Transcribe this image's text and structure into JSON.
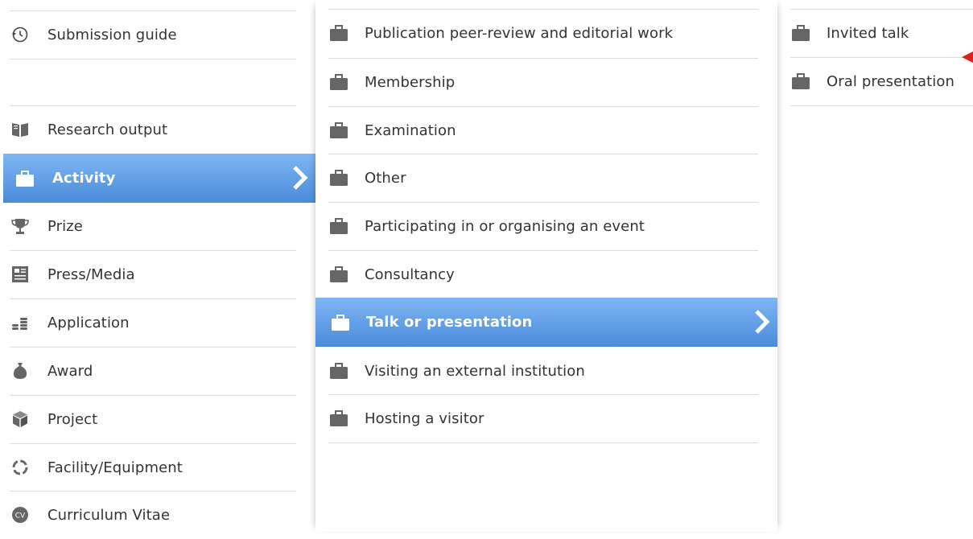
{
  "column1": {
    "items": [
      {
        "label": "Submission guide",
        "icon": "history-icon"
      },
      {
        "label": "",
        "icon": ""
      },
      {
        "label": "Research output",
        "icon": "book-icon"
      },
      {
        "label": "Activity",
        "icon": "briefcase-icon",
        "selected": true
      },
      {
        "label": "Prize",
        "icon": "trophy-icon"
      },
      {
        "label": "Press/Media",
        "icon": "newspaper-icon"
      },
      {
        "label": "Application",
        "icon": "coins-icon"
      },
      {
        "label": "Award",
        "icon": "money-bag-icon"
      },
      {
        "label": "Project",
        "icon": "cube-icon"
      },
      {
        "label": "Facility/Equipment",
        "icon": "lifebuoy-icon"
      },
      {
        "label": "Curriculum Vitae",
        "icon": "cv-icon"
      }
    ]
  },
  "column2": {
    "items": [
      {
        "label": "Publication peer-review and editorial work",
        "icon": "briefcase-icon"
      },
      {
        "label": "Membership",
        "icon": "briefcase-icon"
      },
      {
        "label": "Examination",
        "icon": "briefcase-icon"
      },
      {
        "label": "Other",
        "icon": "briefcase-icon"
      },
      {
        "label": "Participating in or organising an event",
        "icon": "briefcase-icon"
      },
      {
        "label": "Consultancy",
        "icon": "briefcase-icon"
      },
      {
        "label": "Talk or presentation",
        "icon": "briefcase-icon",
        "selected": true
      },
      {
        "label": "Visiting an external institution",
        "icon": "briefcase-icon"
      },
      {
        "label": "Hosting a visitor",
        "icon": "briefcase-icon"
      }
    ]
  },
  "column3": {
    "items": [
      {
        "label": "Invited talk",
        "icon": "briefcase-icon"
      },
      {
        "label": "Oral presentation",
        "icon": "briefcase-icon"
      }
    ]
  },
  "colors": {
    "selected_gradient_top": "#7eb6f4",
    "selected_gradient_bottom": "#4a8bd9",
    "icon_gray": "#666666",
    "divider": "#dcdcdc",
    "pointer_red": "#e0201e"
  }
}
